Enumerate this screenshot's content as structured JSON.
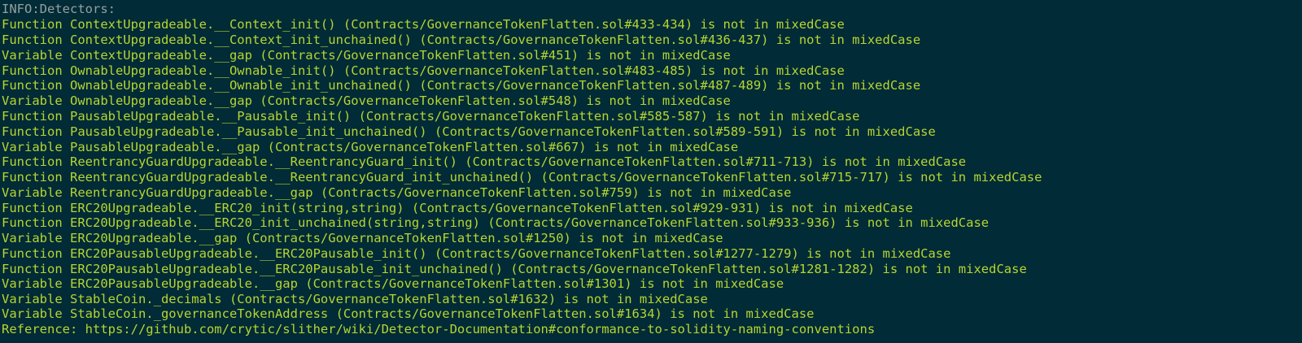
{
  "terminal": {
    "header": "INFO:Detectors:",
    "lines": [
      "Function ContextUpgradeable.__Context_init() (Contracts/GovernanceTokenFlatten.sol#433-434) is not in mixedCase",
      "Function ContextUpgradeable.__Context_init_unchained() (Contracts/GovernanceTokenFlatten.sol#436-437) is not in mixedCase",
      "Variable ContextUpgradeable.__gap (Contracts/GovernanceTokenFlatten.sol#451) is not in mixedCase",
      "Function OwnableUpgradeable.__Ownable_init() (Contracts/GovernanceTokenFlatten.sol#483-485) is not in mixedCase",
      "Function OwnableUpgradeable.__Ownable_init_unchained() (Contracts/GovernanceTokenFlatten.sol#487-489) is not in mixedCase",
      "Variable OwnableUpgradeable.__gap (Contracts/GovernanceTokenFlatten.sol#548) is not in mixedCase",
      "Function PausableUpgradeable.__Pausable_init() (Contracts/GovernanceTokenFlatten.sol#585-587) is not in mixedCase",
      "Function PausableUpgradeable.__Pausable_init_unchained() (Contracts/GovernanceTokenFlatten.sol#589-591) is not in mixedCase",
      "Variable PausableUpgradeable.__gap (Contracts/GovernanceTokenFlatten.sol#667) is not in mixedCase",
      "Function ReentrancyGuardUpgradeable.__ReentrancyGuard_init() (Contracts/GovernanceTokenFlatten.sol#711-713) is not in mixedCase",
      "Function ReentrancyGuardUpgradeable.__ReentrancyGuard_init_unchained() (Contracts/GovernanceTokenFlatten.sol#715-717) is not in mixedCase",
      "Variable ReentrancyGuardUpgradeable.__gap (Contracts/GovernanceTokenFlatten.sol#759) is not in mixedCase",
      "Function ERC20Upgradeable.__ERC20_init(string,string) (Contracts/GovernanceTokenFlatten.sol#929-931) is not in mixedCase",
      "Function ERC20Upgradeable.__ERC20_init_unchained(string,string) (Contracts/GovernanceTokenFlatten.sol#933-936) is not in mixedCase",
      "Variable ERC20Upgradeable.__gap (Contracts/GovernanceTokenFlatten.sol#1250) is not in mixedCase",
      "Function ERC20PausableUpgradeable.__ERC20Pausable_init() (Contracts/GovernanceTokenFlatten.sol#1277-1279) is not in mixedCase",
      "Function ERC20PausableUpgradeable.__ERC20Pausable_init_unchained() (Contracts/GovernanceTokenFlatten.sol#1281-1282) is not in mixedCase",
      "Variable ERC20PausableUpgradeable.__gap (Contracts/GovernanceTokenFlatten.sol#1301) is not in mixedCase",
      "Variable StableCoin._decimals (Contracts/GovernanceTokenFlatten.sol#1632) is not in mixedCase",
      "Variable StableCoin._governanceTokenAddress (Contracts/GovernanceTokenFlatten.sol#1634) is not in mixedCase",
      "Reference: https://github.com/crytic/slither/wiki/Detector-Documentation#conformance-to-solidity-naming-conventions"
    ]
  },
  "colors": {
    "background": "#012b36",
    "info_text": "#93a1a1",
    "warning_text": "#b6d532"
  }
}
